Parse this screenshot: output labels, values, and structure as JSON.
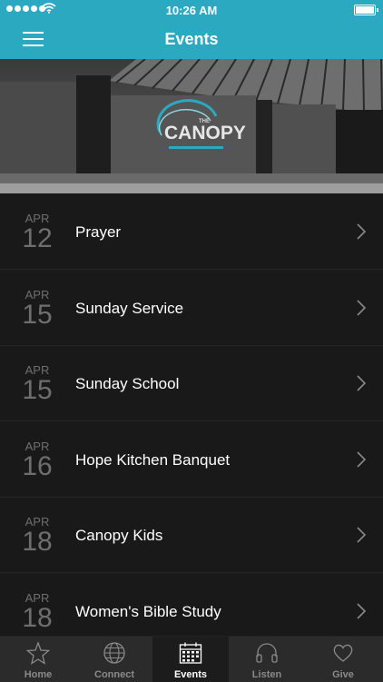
{
  "status_bar": {
    "time": "10:26 AM"
  },
  "header": {
    "title": "Events"
  },
  "hero": {
    "logo_small": "THE",
    "logo_title": "CANOPY"
  },
  "events": [
    {
      "month": "APR",
      "day": "12",
      "title": "Prayer"
    },
    {
      "month": "APR",
      "day": "15",
      "title": "Sunday Service"
    },
    {
      "month": "APR",
      "day": "15",
      "title": "Sunday School"
    },
    {
      "month": "APR",
      "day": "16",
      "title": "Hope Kitchen Banquet"
    },
    {
      "month": "APR",
      "day": "18",
      "title": "Canopy Kids"
    },
    {
      "month": "APR",
      "day": "18",
      "title": "Women's Bible Study"
    }
  ],
  "tabs": [
    {
      "label": "Home",
      "icon": "star-icon"
    },
    {
      "label": "Connect",
      "icon": "globe-icon"
    },
    {
      "label": "Events",
      "icon": "calendar-icon",
      "active": true
    },
    {
      "label": "Listen",
      "icon": "headphones-icon"
    },
    {
      "label": "Give",
      "icon": "heart-icon"
    }
  ],
  "colors": {
    "accent": "#2aa9c0",
    "background": "#191919",
    "tabbar": "#2b2b2b"
  }
}
